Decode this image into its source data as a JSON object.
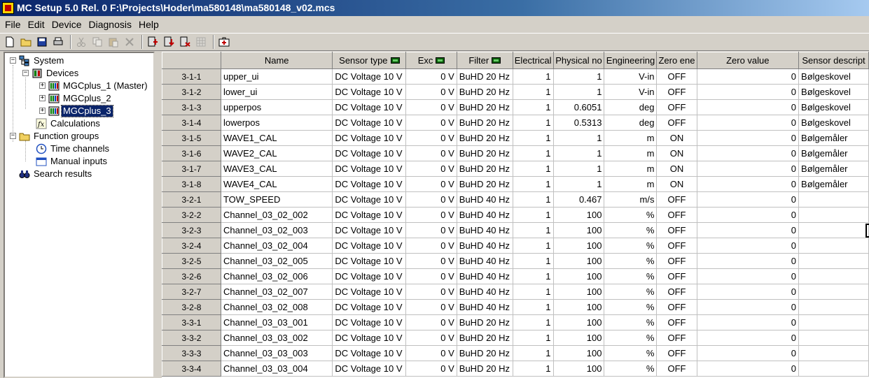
{
  "window": {
    "title": "MC Setup 5.0 Rel. 0 F:\\Projects\\Hoder\\ma580148\\ma580148_v02.mcs"
  },
  "menu": [
    "File",
    "Edit",
    "Device",
    "Diagnosis",
    "Help"
  ],
  "toolbar": [
    {
      "name": "new-file-icon",
      "enabled": true
    },
    {
      "name": "open-folder-icon",
      "enabled": true
    },
    {
      "name": "save-icon",
      "enabled": true
    },
    {
      "name": "print-icon",
      "enabled": true
    },
    {
      "name": "cut-icon",
      "enabled": false
    },
    {
      "name": "copy-icon",
      "enabled": false
    },
    {
      "name": "paste-icon",
      "enabled": false
    },
    {
      "name": "delete-icon",
      "enabled": false
    },
    {
      "name": "device-add-icon",
      "enabled": true
    },
    {
      "name": "device-download-icon",
      "enabled": true
    },
    {
      "name": "device-remove-icon",
      "enabled": true
    },
    {
      "name": "device-grid-icon",
      "enabled": false
    },
    {
      "name": "first-aid-icon",
      "enabled": true
    }
  ],
  "tree": {
    "system": "System",
    "devices": "Devices",
    "device1": "MGCplus_1 (Master)",
    "device2": "MGCplus_2",
    "device3": "MGCplus_3",
    "calculations": "Calculations",
    "function_groups": "Function groups",
    "time_channels": "Time channels",
    "manual_inputs": "Manual inputs",
    "search_results": "Search results"
  },
  "table": {
    "headers": [
      "Name",
      "Sensor type",
      "Exc",
      "Filter",
      "Electrical",
      "Physical no",
      "Engineering",
      "Zero ene",
      "Zero value",
      "Sensor descript"
    ],
    "rows": [
      {
        "id": "3-1-1",
        "name": "upper_ui",
        "sensor": "DC Voltage 10 V",
        "exc": "0 V",
        "filter": "BuHD 20 Hz",
        "elec": "1",
        "phys": "1",
        "eng": "V-in",
        "zero_en": "OFF",
        "zero_val": "0",
        "desc": "Bølgeskovel"
      },
      {
        "id": "3-1-2",
        "name": "lower_ui",
        "sensor": "DC Voltage 10 V",
        "exc": "0 V",
        "filter": "BuHD 20 Hz",
        "elec": "1",
        "phys": "1",
        "eng": "V-in",
        "zero_en": "OFF",
        "zero_val": "0",
        "desc": "Bølgeskovel"
      },
      {
        "id": "3-1-3",
        "name": "upperpos",
        "sensor": "DC Voltage 10 V",
        "exc": "0 V",
        "filter": "BuHD 20 Hz",
        "elec": "1",
        "phys": "0.6051",
        "eng": "deg",
        "zero_en": "OFF",
        "zero_val": "0",
        "desc": "Bølgeskovel"
      },
      {
        "id": "3-1-4",
        "name": "lowerpos",
        "sensor": "DC Voltage 10 V",
        "exc": "0 V",
        "filter": "BuHD 20 Hz",
        "elec": "1",
        "phys": "0.5313",
        "eng": "deg",
        "zero_en": "OFF",
        "zero_val": "0",
        "desc": "Bølgeskovel"
      },
      {
        "id": "3-1-5",
        "name": "WAVE1_CAL",
        "sensor": "DC Voltage 10 V",
        "exc": "0 V",
        "filter": "BuHD 20 Hz",
        "elec": "1",
        "phys": "1",
        "eng": "m",
        "zero_en": "ON",
        "zero_val": "0",
        "desc": "Bølgemåler"
      },
      {
        "id": "3-1-6",
        "name": "WAVE2_CAL",
        "sensor": "DC Voltage 10 V",
        "exc": "0 V",
        "filter": "BuHD 20 Hz",
        "elec": "1",
        "phys": "1",
        "eng": "m",
        "zero_en": "ON",
        "zero_val": "0",
        "desc": "Bølgemåler"
      },
      {
        "id": "3-1-7",
        "name": "WAVE3_CAL",
        "sensor": "DC Voltage 10 V",
        "exc": "0 V",
        "filter": "BuHD 20 Hz",
        "elec": "1",
        "phys": "1",
        "eng": "m",
        "zero_en": "ON",
        "zero_val": "0",
        "desc": "Bølgemåler"
      },
      {
        "id": "3-1-8",
        "name": "WAVE4_CAL",
        "sensor": "DC Voltage 10 V",
        "exc": "0 V",
        "filter": "BuHD 20 Hz",
        "elec": "1",
        "phys": "1",
        "eng": "m",
        "zero_en": "ON",
        "zero_val": "0",
        "desc": "Bølgemåler"
      },
      {
        "id": "3-2-1",
        "name": "TOW_SPEED",
        "sensor": "DC Voltage 10 V",
        "exc": "0 V",
        "filter": "BuHD 40 Hz",
        "elec": "1",
        "phys": "0.467",
        "eng": "m/s",
        "zero_en": "OFF",
        "zero_val": "0",
        "desc": ""
      },
      {
        "id": "3-2-2",
        "name": "Channel_03_02_002",
        "sensor": "DC Voltage 10 V",
        "exc": "0 V",
        "filter": "BuHD 40 Hz",
        "elec": "1",
        "phys": "100",
        "eng": "%",
        "zero_en": "OFF",
        "zero_val": "0",
        "desc": ""
      },
      {
        "id": "3-2-3",
        "name": "Channel_03_02_003",
        "sensor": "DC Voltage 10 V",
        "exc": "0 V",
        "filter": "BuHD 40 Hz",
        "elec": "1",
        "phys": "100",
        "eng": "%",
        "zero_en": "OFF",
        "zero_val": "0",
        "desc": ""
      },
      {
        "id": "3-2-4",
        "name": "Channel_03_02_004",
        "sensor": "DC Voltage 10 V",
        "exc": "0 V",
        "filter": "BuHD 40 Hz",
        "elec": "1",
        "phys": "100",
        "eng": "%",
        "zero_en": "OFF",
        "zero_val": "0",
        "desc": ""
      },
      {
        "id": "3-2-5",
        "name": "Channel_03_02_005",
        "sensor": "DC Voltage 10 V",
        "exc": "0 V",
        "filter": "BuHD 40 Hz",
        "elec": "1",
        "phys": "100",
        "eng": "%",
        "zero_en": "OFF",
        "zero_val": "0",
        "desc": ""
      },
      {
        "id": "3-2-6",
        "name": "Channel_03_02_006",
        "sensor": "DC Voltage 10 V",
        "exc": "0 V",
        "filter": "BuHD 40 Hz",
        "elec": "1",
        "phys": "100",
        "eng": "%",
        "zero_en": "OFF",
        "zero_val": "0",
        "desc": ""
      },
      {
        "id": "3-2-7",
        "name": "Channel_03_02_007",
        "sensor": "DC Voltage 10 V",
        "exc": "0 V",
        "filter": "BuHD 40 Hz",
        "elec": "1",
        "phys": "100",
        "eng": "%",
        "zero_en": "OFF",
        "zero_val": "0",
        "desc": ""
      },
      {
        "id": "3-2-8",
        "name": "Channel_03_02_008",
        "sensor": "DC Voltage 10 V",
        "exc": "0 V",
        "filter": "BuHD 40 Hz",
        "elec": "1",
        "phys": "100",
        "eng": "%",
        "zero_en": "OFF",
        "zero_val": "0",
        "desc": ""
      },
      {
        "id": "3-3-1",
        "name": "Channel_03_03_001",
        "sensor": "DC Voltage 10 V",
        "exc": "0 V",
        "filter": "BuHD 20 Hz",
        "elec": "1",
        "phys": "100",
        "eng": "%",
        "zero_en": "OFF",
        "zero_val": "0",
        "desc": ""
      },
      {
        "id": "3-3-2",
        "name": "Channel_03_03_002",
        "sensor": "DC Voltage 10 V",
        "exc": "0 V",
        "filter": "BuHD 20 Hz",
        "elec": "1",
        "phys": "100",
        "eng": "%",
        "zero_en": "OFF",
        "zero_val": "0",
        "desc": ""
      },
      {
        "id": "3-3-3",
        "name": "Channel_03_03_003",
        "sensor": "DC Voltage 10 V",
        "exc": "0 V",
        "filter": "BuHD 20 Hz",
        "elec": "1",
        "phys": "100",
        "eng": "%",
        "zero_en": "OFF",
        "zero_val": "0",
        "desc": ""
      },
      {
        "id": "3-3-4",
        "name": "Channel_03_03_004",
        "sensor": "DC Voltage 10 V",
        "exc": "0 V",
        "filter": "BuHD 20 Hz",
        "elec": "1",
        "phys": "100",
        "eng": "%",
        "zero_en": "OFF",
        "zero_val": "0",
        "desc": ""
      }
    ]
  }
}
